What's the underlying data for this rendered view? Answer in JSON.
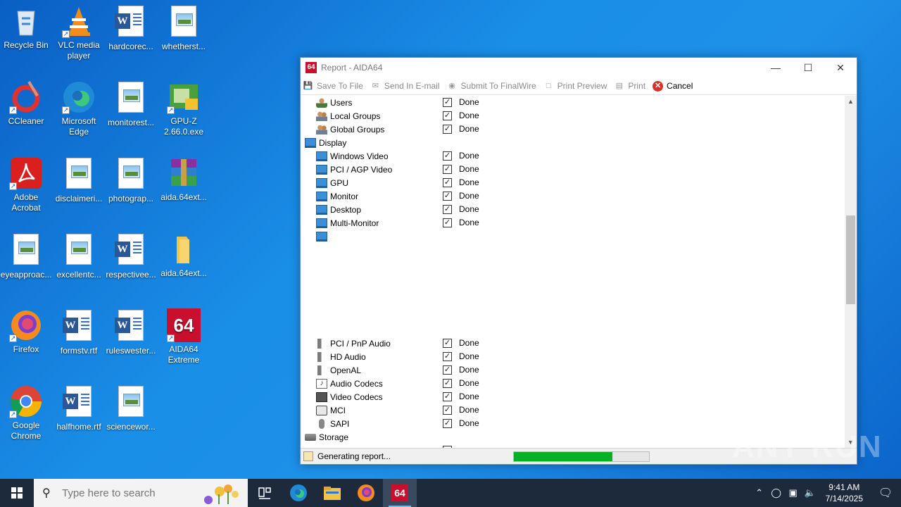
{
  "desktop": {
    "icons": [
      {
        "label": "Recycle Bin",
        "kind": "recycle-bin-icon"
      },
      {
        "label": "VLC media player",
        "kind": "vlc-icon"
      },
      {
        "label": "hardcorec...",
        "kind": "word-document-icon"
      },
      {
        "label": "whetherst...",
        "kind": "image-file-icon"
      },
      {
        "label": "CCleaner",
        "kind": "ccleaner-icon"
      },
      {
        "label": "Microsoft Edge",
        "kind": "edge-icon"
      },
      {
        "label": "monitorest...",
        "kind": "image-file-icon"
      },
      {
        "label": "GPU-Z 2.66.0.exe",
        "kind": "gpuz-icon"
      },
      {
        "label": "Adobe Acrobat",
        "kind": "acrobat-icon"
      },
      {
        "label": "disclaimeri...",
        "kind": "image-file-icon"
      },
      {
        "label": "photograp...",
        "kind": "image-file-icon"
      },
      {
        "label": "aida.64ext...",
        "kind": "winrar-archive-icon"
      },
      {
        "label": "eyeapproac...",
        "kind": "image-file-icon"
      },
      {
        "label": "excellentc...",
        "kind": "image-file-icon"
      },
      {
        "label": "respectivee...",
        "kind": "word-document-icon"
      },
      {
        "label": "aida.64ext...",
        "kind": "folder-icon"
      },
      {
        "label": "Firefox",
        "kind": "firefox-icon"
      },
      {
        "label": "formstv.rtf",
        "kind": "word-document-icon"
      },
      {
        "label": "ruleswester...",
        "kind": "word-document-icon"
      },
      {
        "label": "AIDA64 Extreme",
        "kind": "aida64-icon"
      },
      {
        "label": "Google Chrome",
        "kind": "chrome-icon"
      },
      {
        "label": "halfhome.rtf",
        "kind": "word-document-icon"
      },
      {
        "label": "sciencewor...",
        "kind": "image-file-icon"
      }
    ]
  },
  "window": {
    "logo": "64",
    "title": "Report - AIDA64",
    "controls": {
      "minimize": "—",
      "maximize": "☐",
      "close": "✕"
    },
    "toolbar": {
      "save": "Save To File",
      "email": "Send In E-mail",
      "submit": "Submit To FinalWire",
      "preview": "Print Preview",
      "print": "Print",
      "cancel": "Cancel"
    },
    "rows": [
      {
        "label": "Users",
        "status": "Done",
        "icon": "user-icon",
        "indent": 1
      },
      {
        "label": "Local Groups",
        "status": "Done",
        "icon": "group-icon",
        "indent": 1
      },
      {
        "label": "Global Groups",
        "status": "Done",
        "icon": "group-icon",
        "indent": 1
      },
      {
        "label": "Display",
        "status": "",
        "icon": "monitor-icon",
        "indent": 0
      },
      {
        "label": "Windows Video",
        "status": "Done",
        "icon": "monitor-icon",
        "indent": 1
      },
      {
        "label": "PCI / AGP Video",
        "status": "Done",
        "icon": "monitor-icon",
        "indent": 1
      },
      {
        "label": "GPU",
        "status": "Done",
        "icon": "monitor-icon",
        "indent": 1
      },
      {
        "label": "Monitor",
        "status": "Done",
        "icon": "monitor-icon",
        "indent": 1
      },
      {
        "label": "Desktop",
        "status": "Done",
        "icon": "monitor-icon",
        "indent": 1
      },
      {
        "label": "Multi-Monitor",
        "status": "Done",
        "icon": "monitor-icon",
        "indent": 1
      },
      {
        "label": "",
        "status": "",
        "icon": "monitor-icon",
        "indent": 1
      },
      {
        "label": "PCI / PnP Audio",
        "status": "Done",
        "icon": "speaker-icon",
        "indent": 1
      },
      {
        "label": "HD Audio",
        "status": "Done",
        "icon": "speaker-icon",
        "indent": 1
      },
      {
        "label": "OpenAL",
        "status": "Done",
        "icon": "speaker-icon",
        "indent": 1
      },
      {
        "label": "Audio Codecs",
        "status": "Done",
        "icon": "music-note-icon",
        "indent": 1
      },
      {
        "label": "Video Codecs",
        "status": "Done",
        "icon": "film-icon",
        "indent": 1
      },
      {
        "label": "MCI",
        "status": "Done",
        "icon": "mci-icon",
        "indent": 1
      },
      {
        "label": "SAPI",
        "status": "Done",
        "icon": "microphone-icon",
        "indent": 1
      },
      {
        "label": "Storage",
        "status": "",
        "icon": "disk-icon",
        "indent": 0
      }
    ],
    "statusbar": {
      "text": "Generating report...",
      "progress": 0.73
    }
  },
  "watermark": "ANY RUN",
  "taskbar": {
    "search_placeholder": "Type here to search",
    "apps": [
      "task-view-icon",
      "edge-icon",
      "file-explorer-icon",
      "firefox-icon",
      "aida64-icon"
    ],
    "active_app_label": "64",
    "time": "9:41 AM",
    "date": "7/14/2025"
  }
}
